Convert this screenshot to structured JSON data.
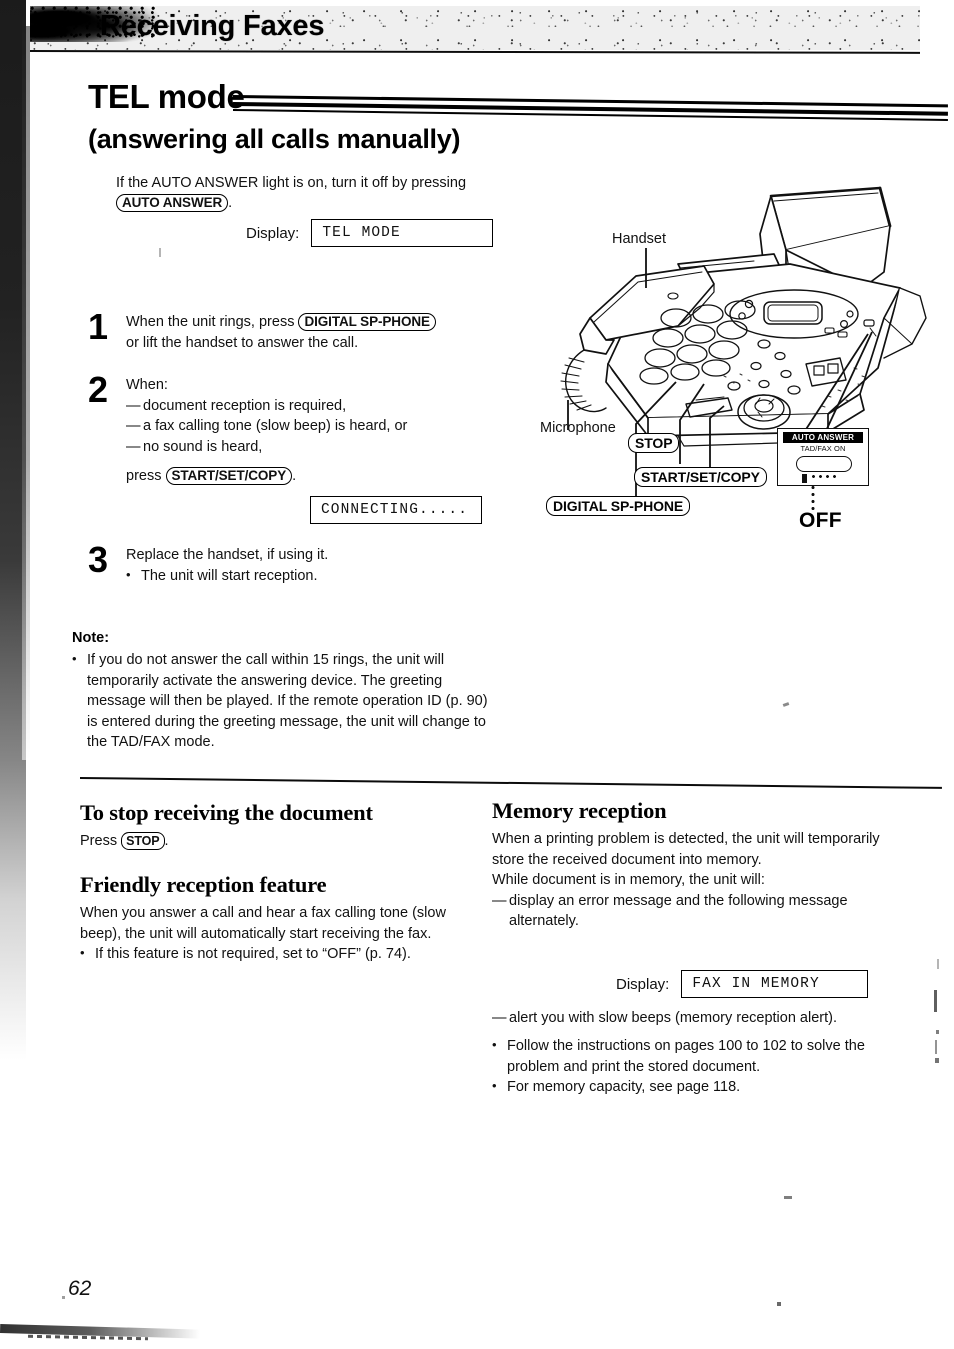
{
  "header": {
    "title": "Receiving Faxes"
  },
  "section": {
    "heading": "TEL mode",
    "subheading": "(answering all calls manually)"
  },
  "intro": {
    "text_before": "If the AUTO ANSWER light is on, turn it off by pressing",
    "button": "AUTO ANSWER",
    "text_after": "."
  },
  "displays": {
    "label": "Display:",
    "tel_mode": "TEL MODE",
    "connecting": "CONNECTING.....",
    "fax_in_memory": "FAX IN MEMORY"
  },
  "steps": [
    {
      "number": "1",
      "line1_before": "When the unit rings, press",
      "button": "DIGITAL SP-PHONE",
      "line2": "or lift the handset to answer the call."
    },
    {
      "number": "2",
      "intro": "When:",
      "dashes": [
        "document reception is required,",
        "a fax calling tone (slow beep) is heard, or",
        "no sound is heard,"
      ],
      "press_before": "press",
      "button": "START/SET/COPY",
      "press_after": "."
    },
    {
      "number": "3",
      "line1": "Replace the handset, if using it.",
      "bullet": "The unit will start reception."
    }
  ],
  "note": {
    "title": "Note:",
    "bullet": "If you do not answer the call within 15 rings, the unit will temporarily activate the answering device. The greeting message will then be played. If the remote operation ID (p. 90) is entered during the greeting message, the unit will change to the TAD/FAX mode."
  },
  "lower_left": {
    "stop_heading": "To stop receiving the document",
    "stop_press_before": "Press",
    "stop_button": "STOP",
    "stop_press_after": ".",
    "friendly_heading": "Friendly reception feature",
    "friendly_body": "When you answer a call and hear a fax calling tone (slow beep), the unit will automatically start receiving the fax.",
    "friendly_bullet": "If this feature is not required, set to “OFF” (p. 74)."
  },
  "lower_right": {
    "memory_heading": "Memory reception",
    "memory_body1": "When a printing problem is detected, the unit will temporarily store the received document into memory.",
    "memory_body2": "While document is in memory, the unit will:",
    "memory_dash1": "display an error message and the following message alternately.",
    "memory_dash2": "alert you with slow beeps (memory reception alert).",
    "memory_bullet1": "Follow the instructions on pages 100 to 102 to solve the problem and print the stored document.",
    "memory_bullet2": "For memory capacity, see page 118."
  },
  "illustration": {
    "label_handset": "Handset",
    "label_microphone": "Microphone",
    "btn_stop": "STOP",
    "btn_start_set_copy": "START/SET/COPY",
    "btn_digital_sp_phone": "DIGITAL SP-PHONE",
    "callout_tag": "AUTO ANSWER",
    "callout_sub": "TAD/FAX ON",
    "off_label": "OFF"
  },
  "footer": {
    "page_number": "62"
  }
}
